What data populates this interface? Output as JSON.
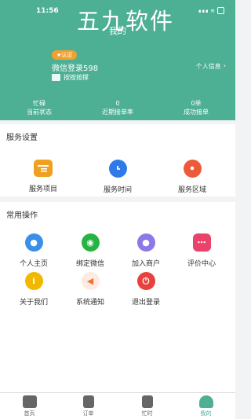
{
  "status": {
    "time": "11:56",
    "signal": "∎∎∎ ≋"
  },
  "watermark": "五九软件",
  "page_title": "我的",
  "user": {
    "badge": "★认证",
    "name": "微信登录598",
    "order_line": "按按按撑",
    "profile_link": "个人信息",
    "chevron": "›"
  },
  "stats": [
    {
      "value": "忙碌",
      "label": "当前状态"
    },
    {
      "value": "0",
      "label": "近期接单率"
    },
    {
      "value": "0单",
      "label": "成功接单"
    }
  ],
  "service": {
    "title": "服务设置",
    "items": [
      {
        "label": "服务项目",
        "color": "#f0a020",
        "icon": "list-icon"
      },
      {
        "label": "服务时间",
        "color": "#2f7ae8",
        "icon": "clock-icon"
      },
      {
        "label": "服务区域",
        "color": "#ec5a3a",
        "icon": "location-icon"
      }
    ]
  },
  "common": {
    "title": "常用操作",
    "items": [
      {
        "label": "个人主页",
        "color": "#3a8fe8",
        "icon": "user-icon",
        "glyph": "●"
      },
      {
        "label": "绑定微信",
        "color": "#27b244",
        "icon": "wechat-icon",
        "glyph": "◉"
      },
      {
        "label": "加入商户",
        "color": "#8e78e6",
        "icon": "users-icon",
        "glyph": "●"
      },
      {
        "label": "评价中心",
        "color": "#e9436c",
        "icon": "message-icon",
        "glyph": "⋯"
      },
      {
        "label": "关于我们",
        "color": "#f2b800",
        "icon": "info-icon",
        "glyph": "i"
      },
      {
        "label": "系统通知",
        "color": "#fdebe2",
        "icon": "speaker-icon",
        "glyph": "◀"
      },
      {
        "label": "退出登录",
        "color": "#e8413d",
        "icon": "power-icon",
        "glyph": "⏻"
      }
    ]
  },
  "nav": [
    {
      "label": "首页",
      "icon": "home-icon"
    },
    {
      "label": "订单",
      "icon": "orders-icon"
    },
    {
      "label": "忙时",
      "icon": "busy-icon"
    },
    {
      "label": "我的",
      "icon": "profile-icon"
    }
  ]
}
